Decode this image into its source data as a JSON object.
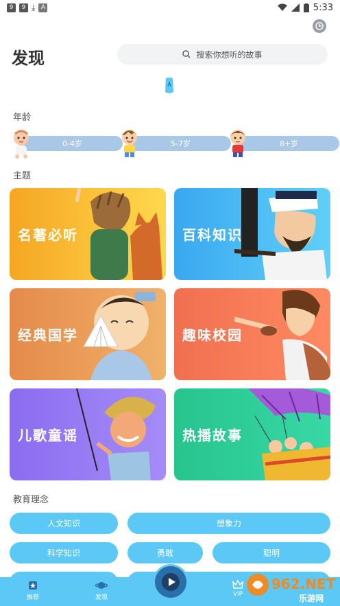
{
  "status_bar": {
    "time": "5:33"
  },
  "header": {
    "title": "发现",
    "search_placeholder": "搜索你想听的故事"
  },
  "sections": {
    "age": "年龄",
    "topic": "主题",
    "education": "教育理念"
  },
  "age_groups": [
    {
      "label": "0-4岁",
      "icon": "baby-icon"
    },
    {
      "label": "5-7岁",
      "icon": "boy-icon"
    },
    {
      "label": "8+岁",
      "icon": "child-icon"
    }
  ],
  "topics": [
    {
      "label": "名著必听",
      "color": "#f5a623"
    },
    {
      "label": "百科知识",
      "color": "#3aa8f0"
    },
    {
      "label": "经典国学",
      "color": "#e58a4a"
    },
    {
      "label": "趣味校园",
      "color": "#f07050"
    },
    {
      "label": "儿歌童谣",
      "color": "#8b6cf0"
    },
    {
      "label": "热播故事",
      "color": "#27c48e"
    }
  ],
  "education_tags": [
    "人文知识",
    "想象力",
    "科学知识",
    "勇敢",
    "聪明"
  ],
  "bottom_nav": [
    {
      "label": "推荐",
      "icon": "home-star-icon"
    },
    {
      "label": "发现",
      "icon": "planet-icon"
    },
    {
      "label": "VIP",
      "icon": "crown-icon"
    }
  ],
  "watermark": {
    "brand": "962.NET",
    "sub": "乐游网"
  }
}
